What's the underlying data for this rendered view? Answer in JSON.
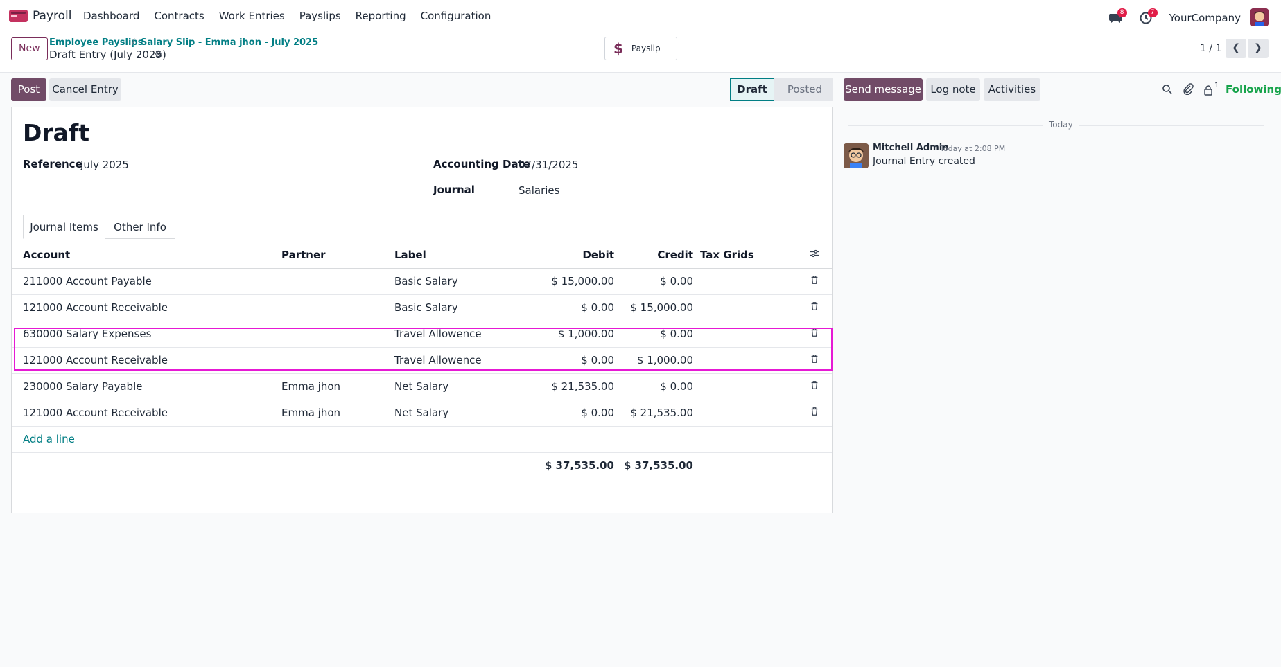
{
  "navbar": {
    "app_name": "Payroll",
    "menu": [
      "Dashboard",
      "Contracts",
      "Work Entries",
      "Payslips",
      "Reporting",
      "Configuration"
    ],
    "messages_badge": "8",
    "activities_badge": "7",
    "company": "YourCompany"
  },
  "control": {
    "new_label": "New",
    "breadcrumb": [
      "Employee Payslips",
      "Salary Slip - Emma jhon - July 2025"
    ],
    "breadcrumb_sep": "/",
    "current": "Draft Entry (July 2025)",
    "payslip_label": "Payslip",
    "pager": "1 / 1"
  },
  "actions": {
    "post_label": "Post",
    "cancel_label": "Cancel Entry"
  },
  "status": {
    "draft": "Draft",
    "posted": "Posted"
  },
  "form": {
    "title": "Draft",
    "reference_label": "Reference",
    "reference_value": "July 2025",
    "accounting_date_label": "Accounting Date",
    "accounting_date_value": "07/31/2025",
    "journal_label": "Journal",
    "journal_value": "Salaries"
  },
  "tabs": [
    "Journal Items",
    "Other Info"
  ],
  "table": {
    "headers": [
      "Account",
      "Partner",
      "Label",
      "Debit",
      "Credit",
      "Tax Grids"
    ],
    "rows": [
      {
        "account": "211000 Account Payable",
        "partner": "",
        "label": "Basic Salary",
        "debit": "$ 15,000.00",
        "credit": "$ 0.00"
      },
      {
        "account": "121000 Account Receivable",
        "partner": "",
        "label": "Basic Salary",
        "debit": "$ 0.00",
        "credit": "$ 15,000.00"
      },
      {
        "account": "630000 Salary Expenses",
        "partner": "",
        "label": "Travel Allowence",
        "debit": "$ 1,000.00",
        "credit": "$ 0.00"
      },
      {
        "account": "121000 Account Receivable",
        "partner": "",
        "label": "Travel Allowence",
        "debit": "$ 0.00",
        "credit": "$ 1,000.00"
      },
      {
        "account": "230000 Salary Payable",
        "partner": "Emma jhon",
        "label": "Net Salary",
        "debit": "$ 21,535.00",
        "credit": "$ 0.00"
      },
      {
        "account": "121000 Account Receivable",
        "partner": "Emma jhon",
        "label": "Net Salary",
        "debit": "$ 0.00",
        "credit": "$ 21,535.00"
      }
    ],
    "add_line": "Add a line",
    "total_debit": "$ 37,535.00",
    "total_credit": "$ 37,535.00"
  },
  "chatter": {
    "send_message": "Send message",
    "log_note": "Log note",
    "activities": "Activities",
    "followers_count": "1",
    "following": "Following",
    "today": "Today",
    "author": "Mitchell Admin",
    "time": "Today at 2:08 PM",
    "body": "Journal Entry created"
  },
  "colors": {
    "primary": "#714b67",
    "link": "#017e84",
    "highlight": "#e619d4",
    "following": "#16a34a"
  }
}
